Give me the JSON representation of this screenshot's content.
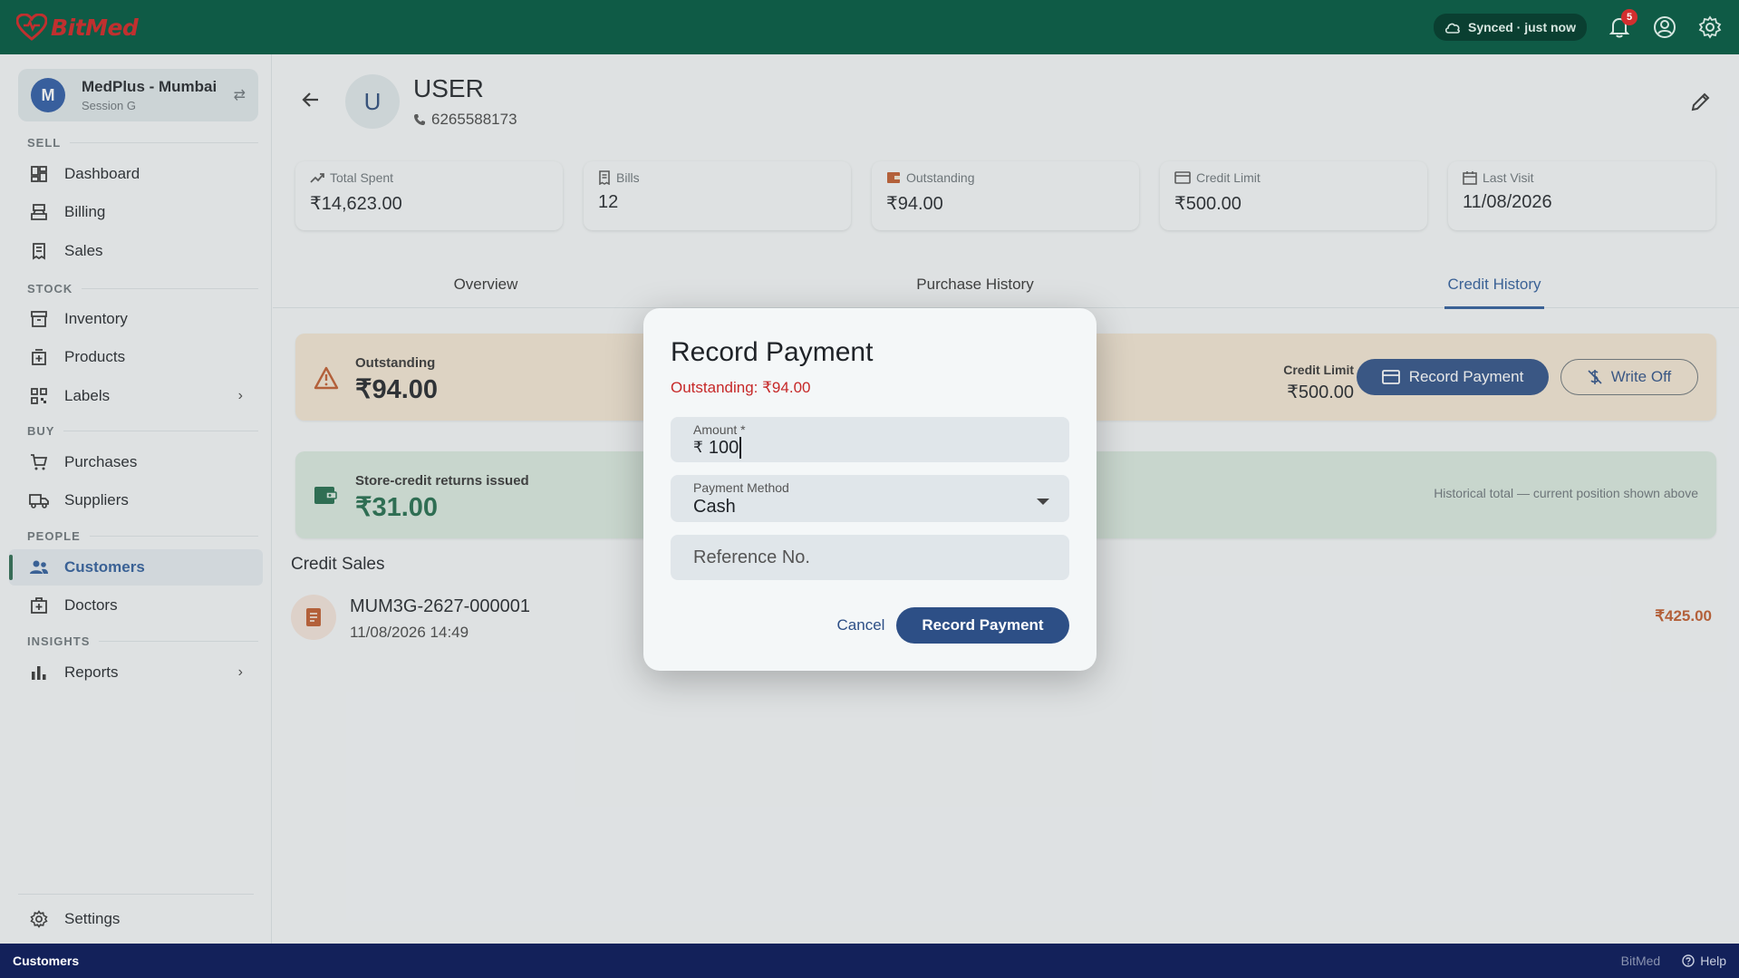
{
  "app": {
    "name": "BitMed"
  },
  "topbar": {
    "sync_status": "Synced · just now",
    "notification_count": "5"
  },
  "store": {
    "avatar": "M",
    "name": "MedPlus - Mumbai",
    "session": "Session G"
  },
  "sidebar": {
    "sections": [
      "SELL",
      "STOCK",
      "BUY",
      "PEOPLE",
      "INSIGHTS"
    ],
    "items": [
      {
        "label": "Dashboard",
        "icon": "dashboard-icon"
      },
      {
        "label": "Billing",
        "icon": "billing-icon"
      },
      {
        "label": "Sales",
        "icon": "receipt-icon"
      },
      {
        "label": "Inventory",
        "icon": "inventory-icon"
      },
      {
        "label": "Products",
        "icon": "products-icon"
      },
      {
        "label": "Labels",
        "icon": "qr-icon"
      },
      {
        "label": "Purchases",
        "icon": "cart-icon"
      },
      {
        "label": "Suppliers",
        "icon": "truck-icon"
      },
      {
        "label": "Customers",
        "icon": "people-icon"
      },
      {
        "label": "Doctors",
        "icon": "medical-bag-icon"
      },
      {
        "label": "Reports",
        "icon": "bar-chart-icon"
      }
    ],
    "settings_label": "Settings"
  },
  "customer": {
    "avatar": "U",
    "name": "USER",
    "phone": "6265588173"
  },
  "stats": [
    {
      "label": "Total Spent",
      "value": "₹14,623.00"
    },
    {
      "label": "Bills",
      "value": "12"
    },
    {
      "label": "Outstanding",
      "value": "₹94.00"
    },
    {
      "label": "Credit Limit",
      "value": "₹500.00"
    },
    {
      "label": "Last Visit",
      "value": "11/08/2026"
    }
  ],
  "tabs": [
    "Overview",
    "Purchase History",
    "Credit History"
  ],
  "outstanding_banner": {
    "label": "Outstanding",
    "value": "₹94.00",
    "credit_limit_label": "Credit Limit",
    "credit_limit_value": "₹500.00",
    "record_payment_label": "Record Payment",
    "write_off_label": "Write Off"
  },
  "store_credit_banner": {
    "label": "Store-credit returns issued",
    "value": "₹31.00",
    "note": "Historical total — current position shown above"
  },
  "credit_sales": {
    "title": "Credit Sales",
    "items": [
      {
        "number": "MUM3G-2627-000001",
        "datetime": "11/08/2026 14:49",
        "amount": "₹425.00"
      }
    ]
  },
  "dialog": {
    "title": "Record Payment",
    "outstanding_text": "Outstanding: ₹94.00",
    "amount_label": "Amount *",
    "amount_prefix": "₹",
    "amount_value": "100",
    "method_label": "Payment Method",
    "method_value": "Cash",
    "reference_placeholder": "Reference No.",
    "cancel_label": "Cancel",
    "submit_label": "Record Payment"
  },
  "statusbar": {
    "page": "Customers",
    "brand": "BitMed",
    "help_label": "Help"
  },
  "colors": {
    "topbar": "#0f5b46",
    "accent": "#2d4f86",
    "outstanding_red": "#c62828",
    "statusbar": "#13215a"
  }
}
